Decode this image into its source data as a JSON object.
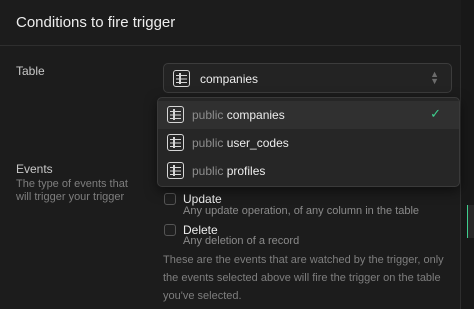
{
  "header": {
    "title": "Conditions to fire trigger"
  },
  "table_field": {
    "label": "Table",
    "selected_value": "companies",
    "options": [
      {
        "schema": "public",
        "name": "companies",
        "selected": true
      },
      {
        "schema": "public",
        "name": "user_codes",
        "selected": false
      },
      {
        "schema": "public",
        "name": "profiles",
        "selected": false
      }
    ]
  },
  "events_field": {
    "label": "Events",
    "description": "The type of events that will trigger your trigger",
    "options": [
      {
        "label": "Update",
        "description": "Any update operation, of any column in the table",
        "checked": false
      },
      {
        "label": "Delete",
        "description": "Any deletion of a record",
        "checked": false
      }
    ],
    "footnote": "These are the events that are watched by the trigger, only the events selected above will fire the trigger on the table you've selected."
  },
  "icons": {
    "table": "table-icon",
    "chevron": "chevron-up-down-icon",
    "check": "check-icon"
  },
  "colors": {
    "accent": "#3ecf8e",
    "background": "#1c1c1c"
  }
}
